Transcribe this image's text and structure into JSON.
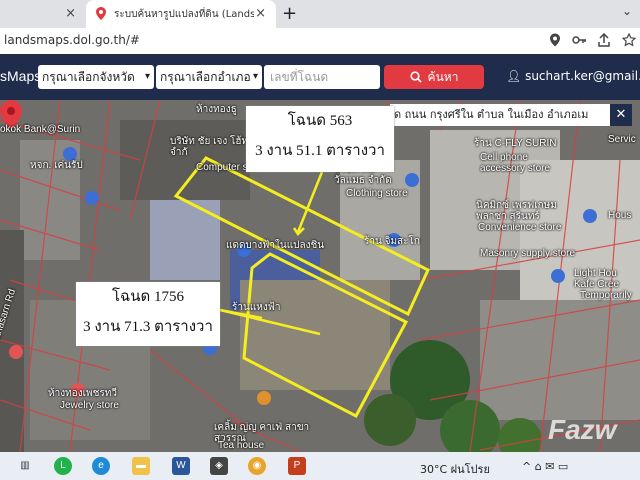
{
  "browser": {
    "tab1_close": "×",
    "tab2_title": "ระบบค้นหารูปแปลงที่ดิน (LandsMaps)",
    "tab2_close": "×",
    "newtab": "+",
    "window_btns": "⌄",
    "url": "landsmaps.dol.go.th/#"
  },
  "header": {
    "brand": "sMaps",
    "province_select": "กรุณาเลือกจังหวัด",
    "district_select": "กรุณาเลือกอำเภอ",
    "deed_placeholder": "เลขที่โฉนด",
    "search_label": "ค้นหา",
    "user_email": "suchart.ker@gmail.co"
  },
  "map": {
    "address_banner": "ด ถนน กรุงศรีใน ตำบล ในเมือง อำเภอเม",
    "close_label": "✕",
    "callout_top": {
      "line1": "โฉนด 563",
      "line2": "3 งาน 51.1 ตารางวา"
    },
    "callout_bottom": {
      "line1": "โฉนด 1756",
      "line2": "3 งาน 71.3 ตารางวา"
    },
    "labels": [
      "okok Bank@Surin",
      "ห้างทองธู",
      "หจก. เค่นรัป",
      "บริษัท ชัย เจง โฮ้ท จำกั",
      "Computer store",
      "บริษัท คิม วัลแมธ จำกัด",
      "Clothing store",
      "ร้าน C-FLY SURIN",
      "Cell phone accessory store",
      "นิคมิกซ์ เพรฟเกษม พลาซ่า สุรินทร์",
      "Convenience store",
      "ร้าน จิมสะโก",
      "Masonry supply store",
      "Light Hou Kafe Cree",
      "Temporarily",
      "Hous",
      "Thanasarn Rd",
      "ร้านแหงฟ้า",
      "ห้างทองเพชรทวี",
      "Jewelry store",
      "เคลิ้ม ญ่ญ คาเฟ่ สาขาสุวรรณ",
      "Tea house",
      "แดดบางฟ้าในแปลงชิน",
      "Servic"
    ],
    "watermark": "Fazw"
  },
  "taskbar": {
    "weather": "30°C ฝนโปรย",
    "tray": "^ ⌂ ✉ ▭"
  },
  "colors": {
    "header_bg": "#1f2c4c",
    "search_btn": "#e23a41",
    "parcel_outline": "#f4ee1f"
  }
}
